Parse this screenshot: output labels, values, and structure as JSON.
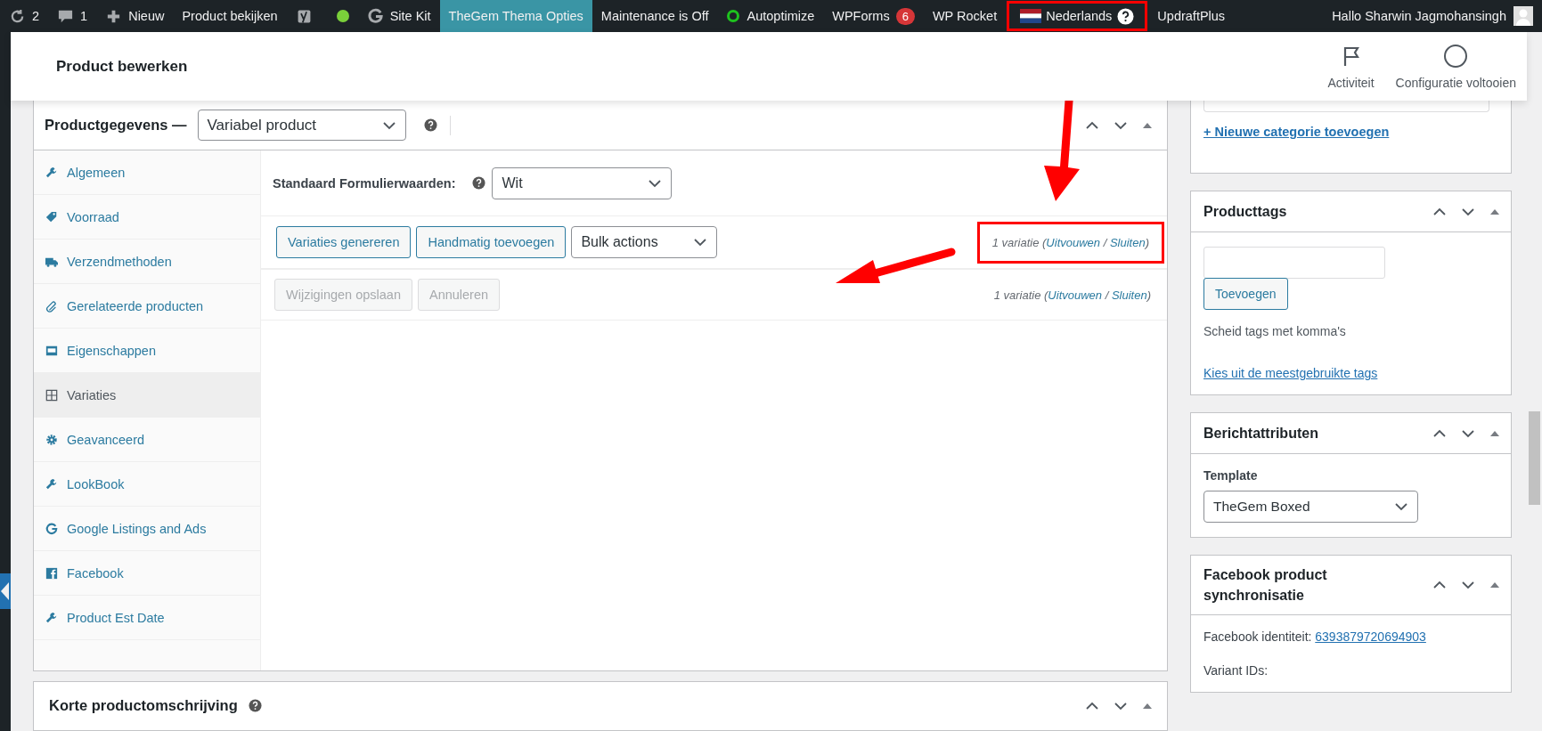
{
  "admin_bar": {
    "items": [
      {
        "kind": "updates",
        "label": "2",
        "selected": false,
        "highlighted": false
      },
      {
        "kind": "comments",
        "label": "1",
        "selected": false,
        "highlighted": false
      },
      {
        "kind": "new",
        "label": "Nieuw",
        "selected": false,
        "highlighted": false
      },
      {
        "kind": "text",
        "label": "Product bekijken",
        "selected": false,
        "highlighted": false
      },
      {
        "kind": "yoast",
        "selected": false,
        "highlighted": false
      },
      {
        "kind": "dot",
        "color": "#7ad03a",
        "selected": false,
        "highlighted": false
      },
      {
        "kind": "sitekit",
        "label": "Site Kit",
        "selected": false,
        "highlighted": false
      },
      {
        "kind": "text",
        "label": "TheGem Thema Opties",
        "selected": true,
        "highlighted": false
      },
      {
        "kind": "text",
        "label": "Maintenance is Off",
        "selected": false,
        "highlighted": false
      },
      {
        "kind": "autoptimize",
        "label": "Autoptimize",
        "selected": false,
        "highlighted": false
      },
      {
        "kind": "text",
        "label": "WPForms",
        "badge": "6",
        "selected": false,
        "highlighted": false
      },
      {
        "kind": "text",
        "label": "WP Rocket",
        "selected": false,
        "highlighted": false
      },
      {
        "kind": "language",
        "label": "Nederlands",
        "selected": false,
        "highlighted": true
      },
      {
        "kind": "text",
        "label": "UpdraftPlus",
        "selected": false,
        "highlighted": false
      }
    ],
    "account": "Hallo Sharwin Jagmohansingh"
  },
  "header": {
    "title": "Product bewerken",
    "actions": [
      {
        "kind": "flag",
        "label": "Activiteit"
      },
      {
        "kind": "circle",
        "label": "Configuratie voltooien"
      }
    ]
  },
  "product_data": {
    "title": "Productgegevens —",
    "type": "Variabel product",
    "tabs": [
      {
        "kind": "wrench",
        "label": "Algemeen",
        "selected": false
      },
      {
        "kind": "tag",
        "label": "Voorraad",
        "selected": false
      },
      {
        "kind": "truck",
        "label": "Verzendmethoden",
        "selected": false
      },
      {
        "kind": "link",
        "label": "Gerelateerde producten",
        "selected": false
      },
      {
        "kind": "card",
        "label": "Eigenschappen",
        "selected": false
      },
      {
        "kind": "grid",
        "label": "Variaties",
        "selected": true
      },
      {
        "kind": "gear",
        "label": "Geavanceerd",
        "selected": false
      },
      {
        "kind": "wrench",
        "label": "LookBook",
        "selected": false
      },
      {
        "kind": "google",
        "label": "Google Listings and Ads",
        "selected": false
      },
      {
        "kind": "facebook",
        "label": "Facebook",
        "selected": false
      },
      {
        "kind": "wrench",
        "label": "Product Est Date",
        "selected": false
      }
    ],
    "defaults": {
      "label": "Standaard Formulierwaarden:",
      "value": "Wit"
    },
    "actions": {
      "buttons": [
        "Variaties genereren",
        "Handmatig toevoegen"
      ],
      "bulk": "Bulk actions",
      "count": {
        "prefix": "1 variatie (",
        "expand": "Uitvouwen",
        "separator": " / ",
        "collapse": "Sluiten",
        "suffix": ")",
        "highlighted": true
      }
    },
    "save": {
      "buttons": [
        {
          "label": "Wijzigingen opslaan",
          "disabled": true
        },
        {
          "label": "Annuleren",
          "disabled": true
        }
      ],
      "count": {
        "prefix": "1 variatie (",
        "expand": "Uitvouwen",
        "separator": " / ",
        "collapse": "Sluiten",
        "suffix": ")",
        "highlighted": false
      }
    }
  },
  "short_description": {
    "title": "Korte productomschrijving"
  },
  "sidebar": {
    "categories": {
      "add_link": "+ Nieuwe categorie toevoegen"
    },
    "tags": {
      "title": "Producttags",
      "button": "Toevoegen",
      "hint": "Scheid tags met komma's",
      "link": "Kies uit de meestgebruikte tags"
    },
    "attributes": {
      "title": "Berichtattributen",
      "label": "Template",
      "value": "TheGem Boxed"
    },
    "facebook": {
      "title": "Facebook product synchronisatie",
      "id_label": "Facebook identiteit: ",
      "id": "6393879720694903",
      "variants": "Variant IDs:"
    }
  }
}
